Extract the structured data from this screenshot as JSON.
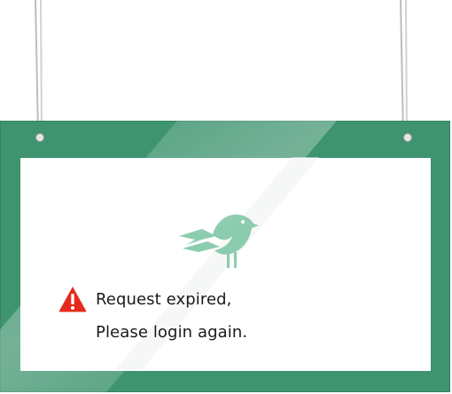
{
  "dialog": {
    "icon": "warning-icon",
    "message_line1": "Request expired,",
    "message_line2": "Please login again."
  },
  "logo": {
    "icon": "bird-logo-icon"
  },
  "colors": {
    "frame": "#3f9470",
    "panel": "#ffffff",
    "warning": "#e52b1f",
    "logo": "#5fb891",
    "text": "#1a1a1a"
  }
}
